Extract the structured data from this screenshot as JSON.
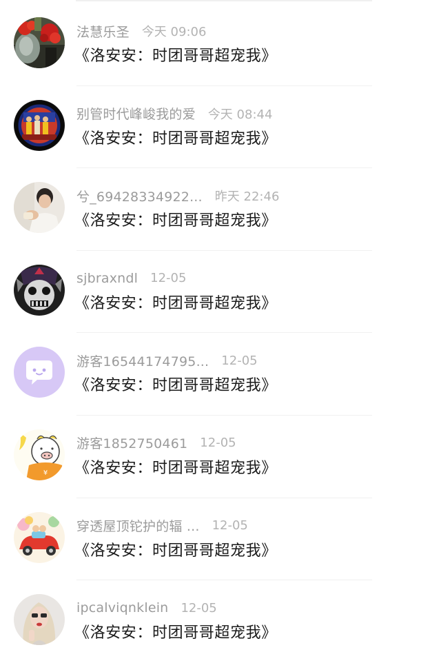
{
  "comments": [
    {
      "username": "法慧乐圣",
      "time": "今天 09:06",
      "message": "《洛安安：时团哥哥超宠我》",
      "avatar": "red-flowers-avatar"
    },
    {
      "username": "别管时代峰峻我的爱",
      "time": "今天 08:44",
      "message": "《洛安安：时团哥哥超宠我》",
      "avatar": "group-photo-avatar"
    },
    {
      "username": "兮_69428334922...",
      "time": "昨天 22:46",
      "message": "《洛安安：时团哥哥超宠我》",
      "avatar": "boy-photo-avatar"
    },
    {
      "username": "sjbraxndl",
      "time": "12-05",
      "message": "《洛安安：时团哥哥超宠我》",
      "avatar": "dark-mask-avatar"
    },
    {
      "username": "游客16544174795...",
      "time": "12-05",
      "message": "《洛安安：时团哥哥超宠我》",
      "avatar": "chat-bubble-avatar"
    },
    {
      "username": "游客1852750461",
      "time": "12-05",
      "message": "《洛安安：时团哥哥超宠我》",
      "avatar": "cartoon-pig-avatar"
    },
    {
      "username": "穿透屋顶铊护的辐 ...",
      "time": "12-05",
      "message": "《洛安安：时团哥哥超宠我》",
      "avatar": "cartoon-car-avatar"
    },
    {
      "username": "ipcalviqnklein",
      "time": "12-05",
      "message": "《洛安安：时团哥哥超宠我》",
      "avatar": "blonde-person-avatar"
    }
  ],
  "colors": {
    "username": "#9b9b9b",
    "time": "#b3b3b3",
    "message": "#1a1a1a",
    "divider": "#f0f0f0",
    "chat_avatar_bg": "#d7c8f6"
  }
}
